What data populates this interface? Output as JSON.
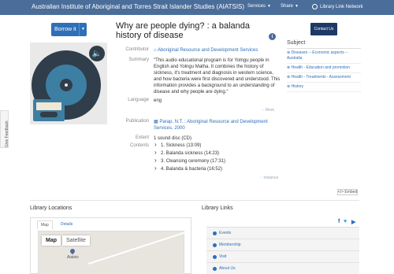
{
  "topbar": {
    "brand": "Australian Institute of Aboriginal and Torres Strait Islander Studies (AIATSIS)",
    "services": "Services",
    "share": "Share",
    "library_network": "Library Link Network"
  },
  "borrow": {
    "label": "Borrow it"
  },
  "feedback": "Give Feedback",
  "title": "Why are people dying? : a balanda history of disease",
  "details": {
    "contributor_label": "Contributor",
    "contributor": "Aboriginal Resource and Development Services",
    "summary_label": "Summary",
    "summary": "\"This audio educational program is for Yolngu people in English and Yolngu Matha. It combines the history of sickness, it's treatment and diagnosis in western science, and how bacteria were first discovered and understood. This information provides a background to an understanding of disease and why people are dying.\"",
    "language_label": "Language",
    "language": "eng",
    "work_link": "Work",
    "publication_label": "Publication",
    "publication": "Parap, N.T. : Aboriginal Resource and Development Services, 2000",
    "extent_label": "Extent",
    "extent": "1 sound disc (CD)",
    "contents_label": "Contents",
    "contents": [
      "1. Sickness (13:09)",
      "2. Balanda sickness (14:23)",
      "3. Cleansing ceremony (17:31)",
      "4. Balanda & bacteria (16:52)"
    ],
    "instance_link": "Instance"
  },
  "contact": "Contact Us",
  "subject": {
    "heading": "Subject",
    "items": [
      "Diseases -- Economic aspects -- Australia",
      "Health - Education and promotion",
      "Health - Treatments - Assessment",
      "History"
    ]
  },
  "embed": "Embed",
  "locations": {
    "heading": "Library Locations",
    "tab_map": "Map",
    "tab_details": "Details",
    "map_button": "Map",
    "satellite_button": "Satellite",
    "pin_label": "Aiatsis"
  },
  "links": {
    "heading": "Library Links",
    "items": [
      "Events",
      "Membership",
      "Visit",
      "About Us"
    ]
  },
  "colors": {
    "nav": "#4a6d9a",
    "accent": "#2e6fb8",
    "contact": "#1d3a66"
  }
}
